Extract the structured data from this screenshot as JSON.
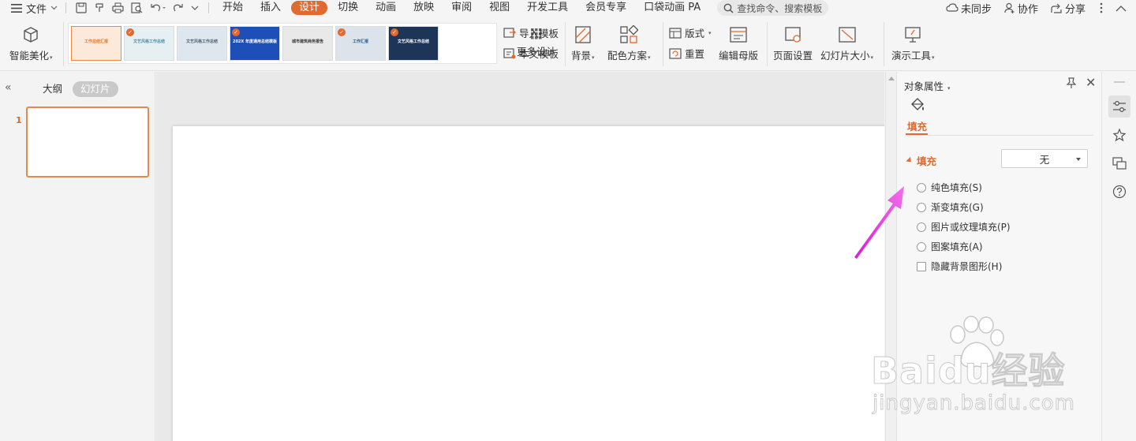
{
  "menubar": {
    "file_label": "文件",
    "tabs": [
      {
        "label": "开始",
        "active": false
      },
      {
        "label": "插入",
        "active": false
      },
      {
        "label": "设计",
        "active": true
      },
      {
        "label": "切换",
        "active": false
      },
      {
        "label": "动画",
        "active": false
      },
      {
        "label": "放映",
        "active": false
      },
      {
        "label": "审阅",
        "active": false
      },
      {
        "label": "视图",
        "active": false
      },
      {
        "label": "开发工具",
        "active": false
      },
      {
        "label": "会员专享",
        "active": false
      },
      {
        "label": "口袋动画 PA",
        "active": false
      }
    ],
    "search_placeholder": "查找命令、搜索模板",
    "sync_label": "未同步",
    "collab_label": "协作",
    "share_label": "分享"
  },
  "ribbon": {
    "beautify_label": "智能美化",
    "templates": [
      {
        "text": "工作总结汇报",
        "bg": "#fbe9d9",
        "fg": "#e0792f",
        "badge": false
      },
      {
        "text": "文艺风格工作总结",
        "bg": "#e6f0f3",
        "fg": "#4b8fa6",
        "badge": true
      },
      {
        "text": "文艺风格工作总结",
        "bg": "#dfe7ee",
        "fg": "#4c6176",
        "badge": false
      },
      {
        "text": "202X 年度通用总结模板",
        "bg": "#1e4fb8",
        "fg": "#ffffff",
        "badge": true
      },
      {
        "text": "城市建筑商务报告",
        "bg": "#e9e9e9",
        "fg": "#333333",
        "badge": false
      },
      {
        "text": "工作汇报",
        "bg": "#dde3ea",
        "fg": "#1d5c8f",
        "badge": true
      },
      {
        "text": "文艺风格工作总结",
        "bg": "#1d3559",
        "fg": "#ffffff",
        "badge": true
      }
    ],
    "more_design_label": "更多设计",
    "import_template_label": "导入模板",
    "this_template_label": "本文模板",
    "background_label": "背景",
    "color_scheme_label": "配色方案",
    "layout_label": "版式",
    "reset_label": "重置",
    "edit_master_label": "编辑母版",
    "page_setup_label": "页面设置",
    "slide_size_label": "幻灯片大小",
    "present_tools_label": "演示工具"
  },
  "leftpane": {
    "outline_label": "大纲",
    "slides_label": "幻灯片",
    "slide_number": "1"
  },
  "props": {
    "title": "对象属性",
    "tab_label": "填充",
    "section_label": "填充",
    "fill_select_value": "无",
    "options": [
      {
        "label": "纯色填充(S)",
        "type": "radio"
      },
      {
        "label": "渐变填充(G)",
        "type": "radio"
      },
      {
        "label": "图片或纹理填充(P)",
        "type": "radio"
      },
      {
        "label": "图案填充(A)",
        "type": "radio"
      },
      {
        "label": "隐藏背景图形(H)",
        "type": "checkbox"
      }
    ]
  },
  "watermark": {
    "brand": "Baidu经验",
    "site": "jingyan.baidu.com"
  },
  "colors": {
    "accent": "#e06a2f",
    "annotation_arrow": "#e83ae0"
  }
}
